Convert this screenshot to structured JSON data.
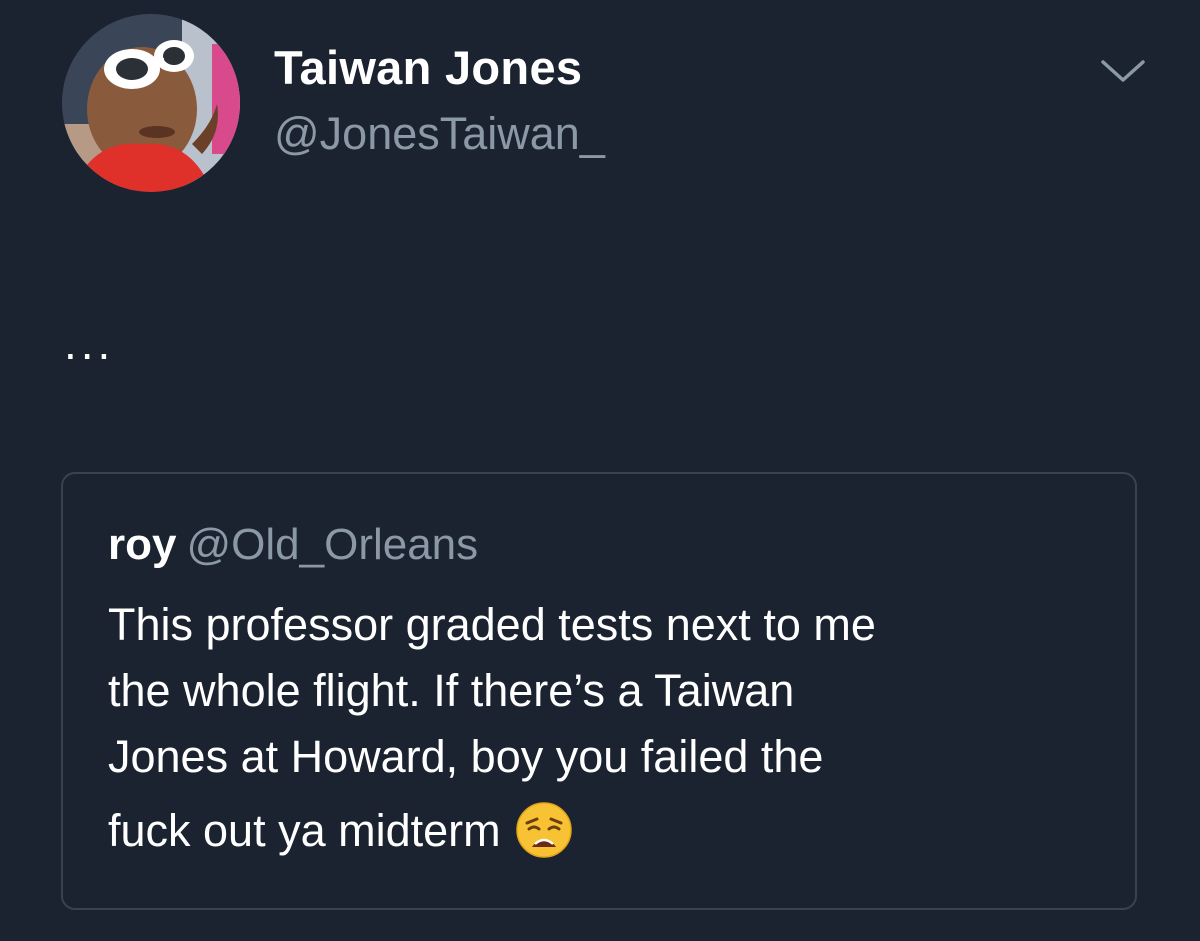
{
  "tweet": {
    "author": {
      "display_name": "Taiwan Jones",
      "handle": "@JonesTaiwan_"
    },
    "text": "...",
    "menu_icon": "chevron-down-icon"
  },
  "quoted_tweet": {
    "author": {
      "display_name": "roy",
      "handle": "@Old_Orleans"
    },
    "lines": [
      "This professor graded tests next to me",
      "the whole flight. If there’s a Taiwan",
      "Jones at Howard, boy you failed the",
      "fuck out ya midterm"
    ],
    "emoji": "weary-face-emoji"
  },
  "colors": {
    "background": "#1b2330",
    "text_primary": "#ffffff",
    "text_secondary": "#8b98a5",
    "card_border": "#38444d"
  }
}
